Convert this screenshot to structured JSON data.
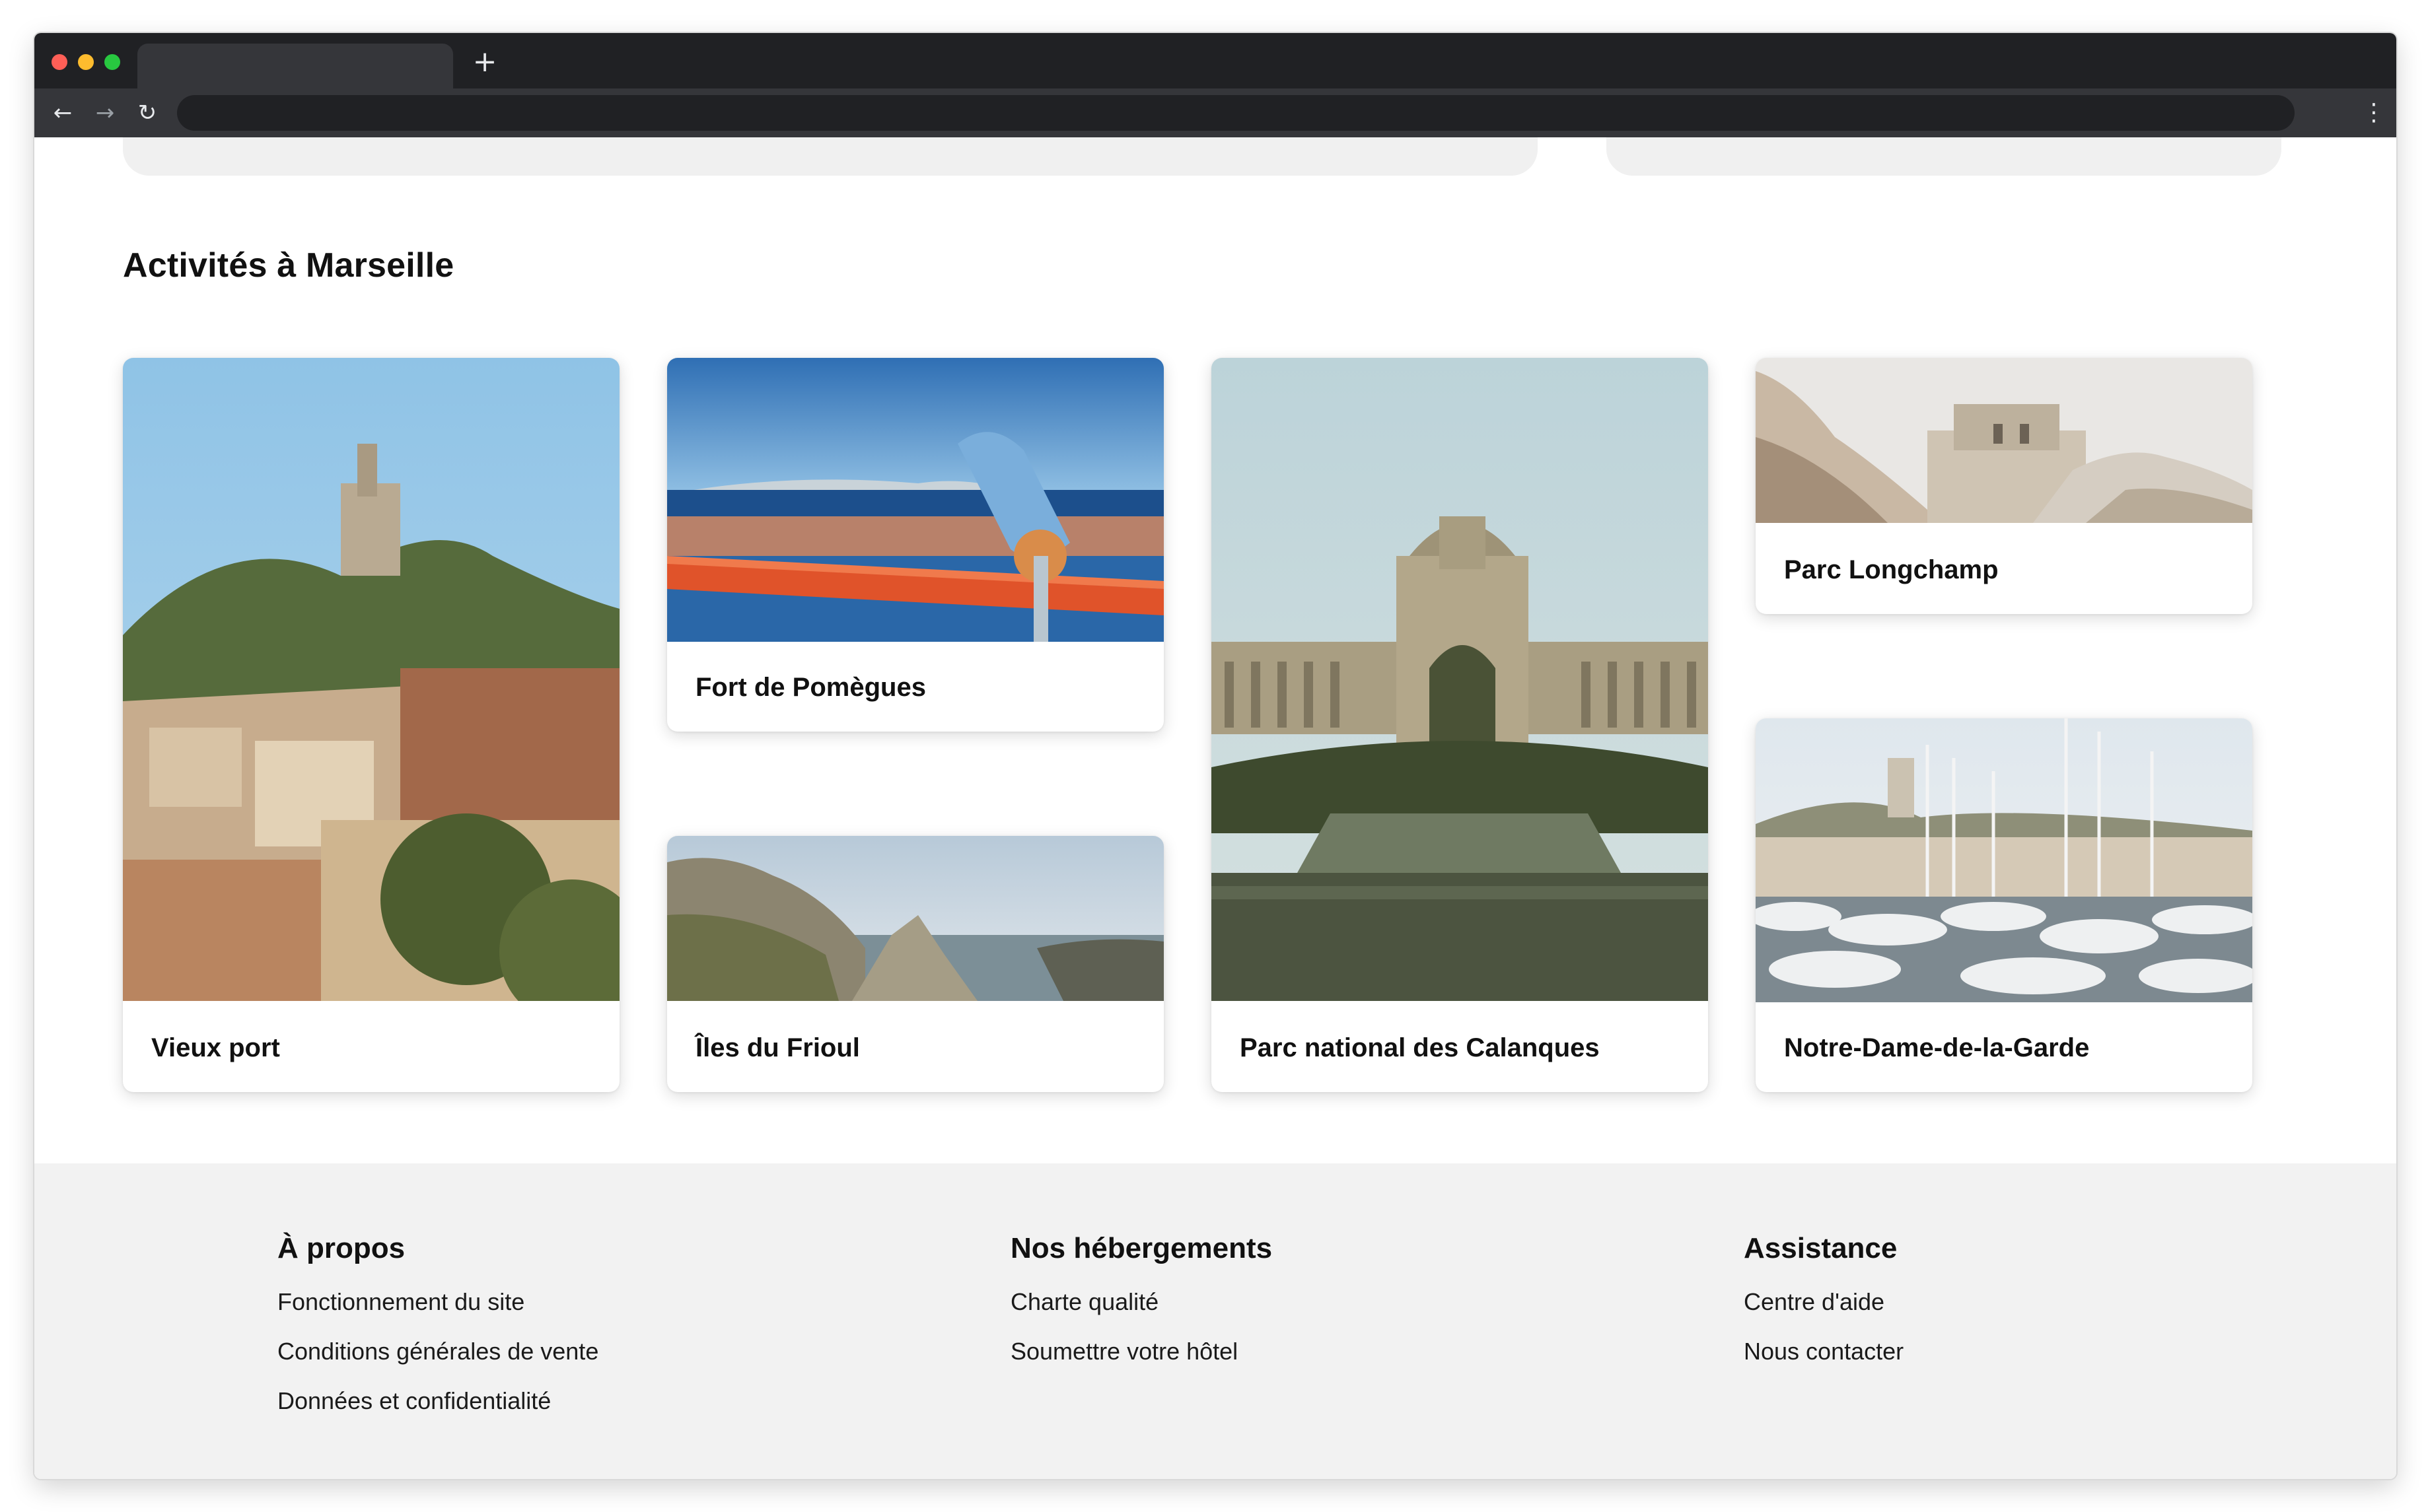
{
  "browser": {
    "new_tab_glyph": "+",
    "back_glyph": "←",
    "forward_glyph": "→",
    "reload_glyph": "↻",
    "menu_glyph": "⋮"
  },
  "activities": {
    "title": "Activités à Marseille",
    "cards": [
      {
        "label": "Vieux port",
        "image": "city-hillside-photo"
      },
      {
        "label": "Fort de Pomègues",
        "image": "harbor-telescope-photo"
      },
      {
        "label": "Îles du Frioul",
        "image": "coastal-cliffs-photo"
      },
      {
        "label": "Parc national des Calanques",
        "image": "palace-fountain-photo"
      },
      {
        "label": "Parc Longchamp",
        "image": "rock-fortress-photo"
      },
      {
        "label": "Notre-Dame-de-la-Garde",
        "image": "marina-boats-photo"
      }
    ]
  },
  "footer": {
    "about": {
      "heading": "À propos",
      "links": [
        "Fonctionnement du site",
        "Conditions générales de vente",
        "Données et confidentialité"
      ]
    },
    "accommodations": {
      "heading": "Nos hébergements",
      "links": [
        "Charte qualité",
        "Soumettre votre hôtel"
      ]
    },
    "support": {
      "heading": "Assistance",
      "links": [
        "Centre d'aide",
        "Nous contacter"
      ]
    }
  },
  "colors": {
    "chrome_dark": "#202124",
    "chrome_toolbar": "#35363a",
    "footer_bg": "#f2f2f2",
    "text": "#111111"
  }
}
